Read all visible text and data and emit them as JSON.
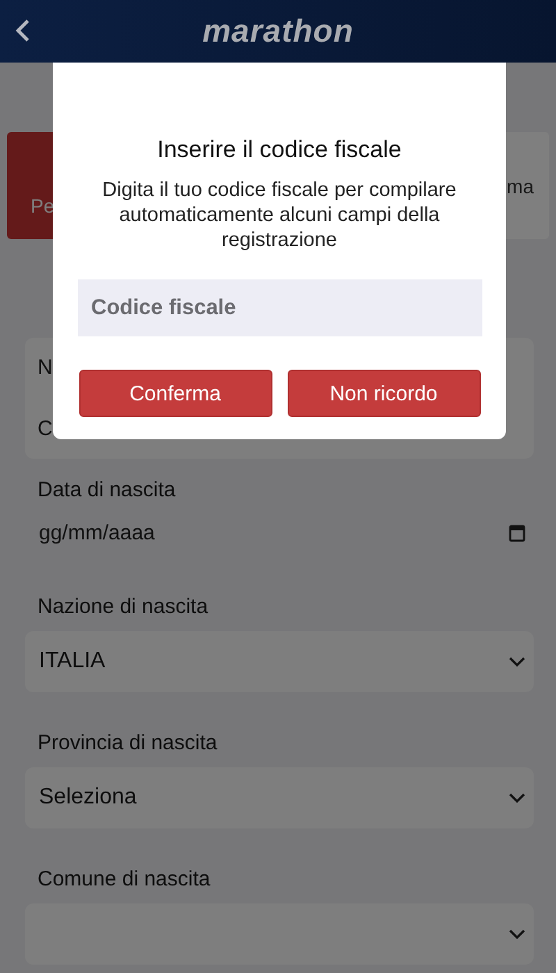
{
  "header": {
    "logo": "marathon"
  },
  "choice_cards": [
    {
      "text": "Pe",
      "selected": true
    },
    {
      "text": "ma",
      "selected": false
    }
  ],
  "name_card": {
    "fields": [
      {
        "label": "N"
      },
      {
        "label": "C"
      }
    ]
  },
  "fields": [
    {
      "kind": "date",
      "label": "Data di nascita",
      "placeholder": "gg/mm/aaaa"
    },
    {
      "kind": "select",
      "label": "Nazione di nascita",
      "value": "ITALIA"
    },
    {
      "kind": "select",
      "label": "Provincia di nascita",
      "value": "Seleziona"
    },
    {
      "kind": "select",
      "label": "Comune di nascita"
    }
  ],
  "dialog": {
    "title": "Inserire il codice fiscale",
    "message": "Digita il tuo codice fiscale per compilare automaticamente alcuni campi della registrazione",
    "input": {
      "placeholder": "Codice fiscale"
    },
    "buttons": [
      "Conferma",
      "Non ricordo"
    ]
  }
}
